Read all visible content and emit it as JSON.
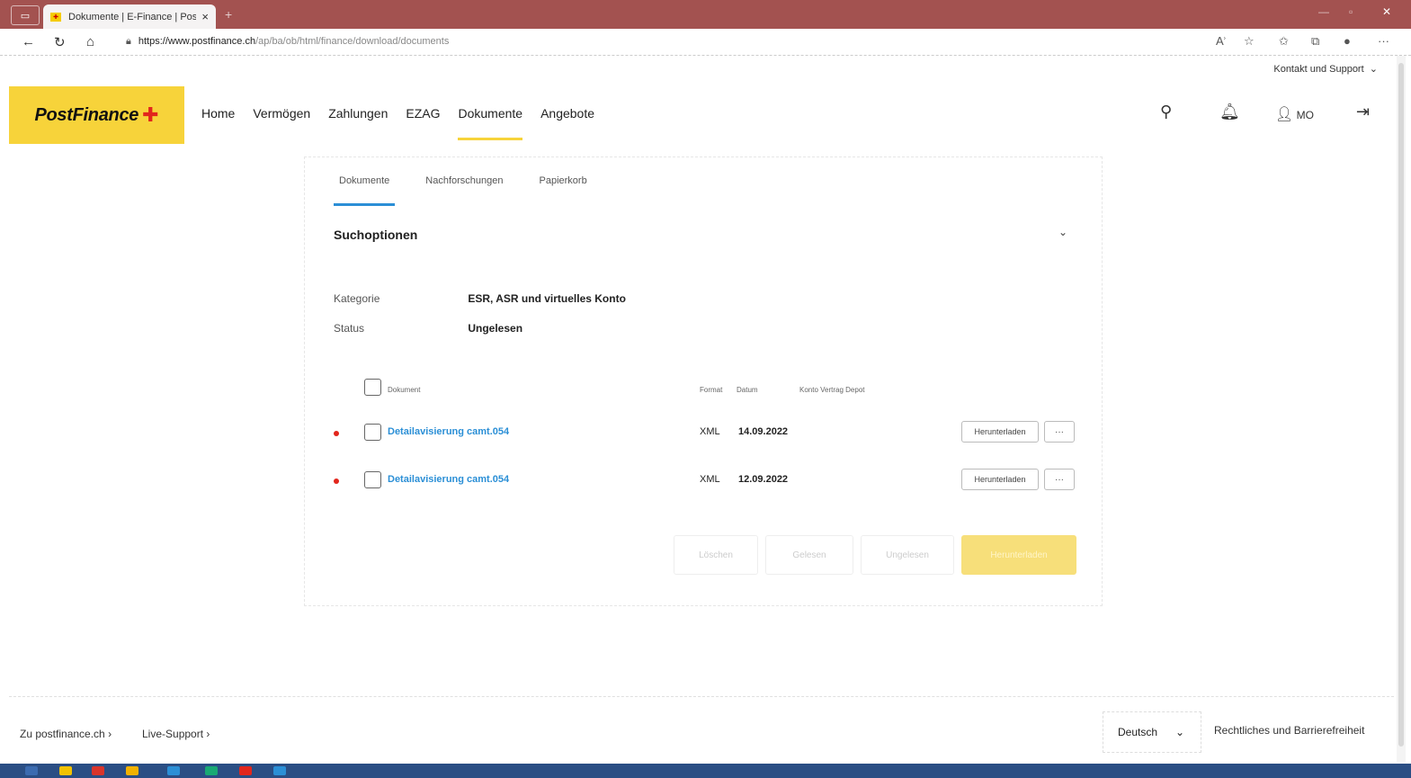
{
  "browser": {
    "tab_title": "Dokumente | E-Finance | PostFi",
    "tab_close": "×",
    "new_tab": "+",
    "url_host": "https://www.postfinance.ch",
    "url_path": "/ap/ba/ob/html/finance/download/documents"
  },
  "header": {
    "kontakt": "Kontakt und Support",
    "brand": "PostFinance",
    "user_initials": "MO",
    "nav": [
      "Home",
      "Vermögen",
      "Zahlungen",
      "EZAG",
      "Dokumente",
      "Angebote"
    ],
    "active_nav": "Dokumente"
  },
  "subtabs": [
    "Dokumente",
    "Nachforschungen",
    "Papierkorb"
  ],
  "search": {
    "title": "Suchoptionen",
    "filters": [
      {
        "label": "Kategorie",
        "value": "ESR, ASR und virtuelles Konto"
      },
      {
        "label": "Status",
        "value": "Ungelesen"
      }
    ]
  },
  "table": {
    "headers": {
      "document": "Dokument",
      "format": "Format",
      "date": "Datum",
      "account": "Konto Vertrag Depot"
    },
    "rows": [
      {
        "name": "Detailavisierung camt.054",
        "format": "XML",
        "date": "14.09.2022",
        "download": "Herunterladen",
        "more": "···"
      },
      {
        "name": "Detailavisierung camt.054",
        "format": "XML",
        "date": "12.09.2022",
        "download": "Herunterladen",
        "more": "···"
      }
    ]
  },
  "actions": [
    "Löschen",
    "Gelesen",
    "Ungelesen",
    "Herunterladen"
  ],
  "footer": {
    "link1": "Zu postfinance.ch",
    "link2": "Live-Support",
    "language": "Deutsch",
    "legal": "Rechtliches und Barrierefreiheit"
  },
  "colors": {
    "brand_yellow": "#f7d33a",
    "link_blue": "#2b8fd6",
    "unread_red": "#e2261c",
    "titlebar": "#a35250"
  }
}
